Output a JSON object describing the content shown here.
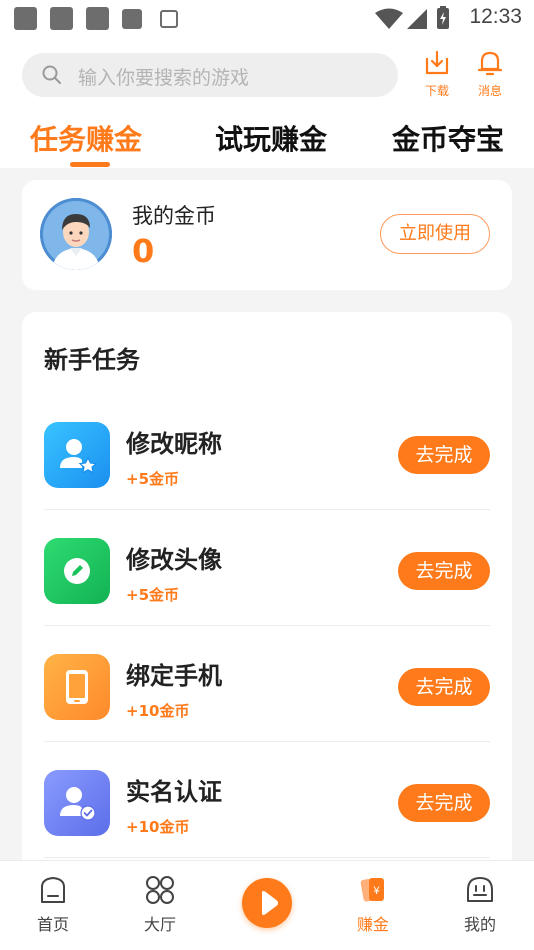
{
  "status_bar": {
    "time": "12:33"
  },
  "search": {
    "placeholder": "输入你要搜索的游戏"
  },
  "header_actions": {
    "download_label": "下载",
    "message_label": "消息"
  },
  "tabs": [
    {
      "label": "任务赚金",
      "active": true
    },
    {
      "label": "试玩赚金",
      "active": false
    },
    {
      "label": "金币夺宝",
      "active": false
    }
  ],
  "coins": {
    "label": "我的金币",
    "value": "0",
    "use_button": "立即使用"
  },
  "tasks": {
    "title": "新手任务",
    "items": [
      {
        "name": "修改昵称",
        "reward": "+5金币",
        "button": "去完成",
        "icon": "user-star-icon",
        "color": "#1fa8f5"
      },
      {
        "name": "修改头像",
        "reward": "+5金币",
        "button": "去完成",
        "icon": "pencil-icon",
        "color": "#17c35b"
      },
      {
        "name": "绑定手机",
        "reward": "+10金币",
        "button": "去完成",
        "icon": "phone-icon",
        "color": "#ff9a3a"
      },
      {
        "name": "实名认证",
        "reward": "+10金币",
        "button": "去完成",
        "icon": "user-check-icon",
        "color": "#6b7ff2"
      }
    ]
  },
  "bottom_nav": [
    {
      "label": "首页",
      "icon": "home-icon"
    },
    {
      "label": "大厅",
      "icon": "grid-icon"
    },
    {
      "label": "",
      "icon": "play-icon"
    },
    {
      "label": "赚金",
      "icon": "earn-icon",
      "active": true
    },
    {
      "label": "我的",
      "icon": "profile-icon"
    }
  ],
  "colors": {
    "accent": "#ff7a1a"
  }
}
